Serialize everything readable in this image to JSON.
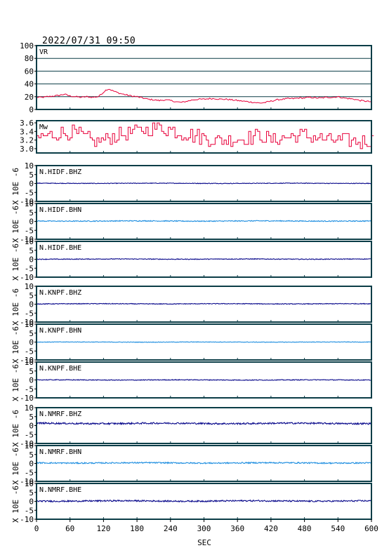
{
  "title": "2022/07/31  09:50",
  "chart_data": {
    "type": "line",
    "title": "2022/07/31  09:50",
    "xlabel": "SEC",
    "xlim": [
      0,
      600
    ],
    "xticks": [
      "0",
      "60",
      "120",
      "180",
      "240",
      "300",
      "360",
      "420",
      "480",
      "540",
      "600"
    ],
    "colors": {
      "red": "#e8003a",
      "navy": "#0a0a8c",
      "azure": "#1e8ee0",
      "frame": "#0b3d47"
    },
    "panels": [
      {
        "label": "VR",
        "ylim": [
          0,
          100
        ],
        "yticks": [
          "100",
          "80",
          "60",
          "40",
          "20",
          "0"
        ],
        "grid": true,
        "color": "red",
        "series_type": "profile",
        "x": [
          0,
          10,
          20,
          30,
          40,
          50,
          60,
          70,
          80,
          90,
          100,
          110,
          115,
          120,
          125,
          130,
          135,
          140,
          150,
          160,
          170,
          180,
          190,
          200,
          210,
          220,
          230,
          240,
          250,
          260,
          270,
          280,
          290,
          300,
          310,
          320,
          330,
          340,
          350,
          360,
          370,
          380,
          390,
          400,
          410,
          420,
          430,
          440,
          450,
          460,
          470,
          480,
          490,
          500,
          510,
          520,
          530,
          540,
          550,
          560,
          570,
          580,
          590,
          600
        ],
        "values": [
          19,
          19,
          20,
          21,
          22,
          24,
          21,
          20,
          19,
          20,
          19,
          20,
          23,
          27,
          31,
          32,
          30,
          28,
          25,
          23,
          21,
          20,
          18,
          16,
          15,
          14,
          15,
          14,
          12,
          11,
          13,
          15,
          16,
          16,
          17,
          17,
          16,
          16,
          15,
          14,
          13,
          12,
          11,
          10,
          11,
          13,
          15,
          16,
          17,
          17,
          18,
          18,
          19,
          18,
          18,
          19,
          19,
          20,
          18,
          17,
          16,
          14,
          13,
          12
        ]
      },
      {
        "label": "Mw",
        "ylim": [
          2.9,
          3.65
        ],
        "yticks": [
          "3.6",
          "3.4",
          "3.2",
          "3.0"
        ],
        "ytick_values": [
          3.6,
          3.4,
          3.2,
          3.0
        ],
        "grid": false,
        "color": "red",
        "series_type": "profile",
        "x": [
          0,
          20,
          40,
          60,
          80,
          100,
          120,
          140,
          160,
          180,
          200,
          220,
          240,
          260,
          280,
          300,
          320,
          340,
          360,
          380,
          400,
          420,
          440,
          460,
          480,
          500,
          520,
          540,
          560,
          580,
          600
        ],
        "values": [
          3.25,
          3.3,
          3.35,
          3.4,
          3.3,
          3.15,
          3.2,
          3.3,
          3.35,
          3.4,
          3.45,
          3.5,
          3.45,
          3.35,
          3.3,
          3.25,
          3.2,
          3.2,
          3.25,
          3.25,
          3.3,
          3.2,
          3.25,
          3.3,
          3.3,
          3.25,
          3.2,
          3.2,
          3.2,
          3.15,
          3.2
        ]
      },
      {
        "label": "N.HIDF.BHZ",
        "ylim": [
          -10,
          10
        ],
        "yticks": [
          "10",
          "5",
          "0",
          "-5",
          "-10"
        ],
        "ylabel": "X 10E -6",
        "color": "navy",
        "series_type": "trace",
        "baseline": 0.1,
        "noise": 0.18
      },
      {
        "label": "N.HIDF.BHN",
        "ylim": [
          -10,
          10
        ],
        "yticks": [
          "10",
          "5",
          "0",
          "-5",
          "-10"
        ],
        "ylabel": "X 10E -6",
        "color": "azure",
        "series_type": "trace",
        "baseline": 0.2,
        "noise": 0.25
      },
      {
        "label": "N.HIDF.BHE",
        "ylim": [
          -10,
          10
        ],
        "yticks": [
          "10",
          "5",
          "0",
          "-5",
          "-10"
        ],
        "ylabel": "X 10E -6",
        "color": "navy",
        "series_type": "trace",
        "baseline": 0.1,
        "noise": 0.2
      },
      {
        "label": "N.KNPF.BHZ",
        "ylim": [
          -10,
          10
        ],
        "yticks": [
          "10",
          "5",
          "0",
          "-5",
          "-10"
        ],
        "ylabel": "X 10E -6",
        "color": "navy",
        "series_type": "trace",
        "baseline": 0.2,
        "noise": 0.2
      },
      {
        "label": "N.KNPF.BHN",
        "ylim": [
          -10,
          10
        ],
        "yticks": [
          "10",
          "5",
          "0",
          "-5",
          "-10"
        ],
        "ylabel": "X 10E -6",
        "color": "azure",
        "series_type": "trace",
        "baseline": 0.0,
        "noise": 0.15
      },
      {
        "label": "N.KNPF.BHE",
        "ylim": [
          -10,
          10
        ],
        "yticks": [
          "10",
          "5",
          "0",
          "-5",
          "-10"
        ],
        "ylabel": "X 10E -6",
        "color": "navy",
        "series_type": "trace",
        "baseline": 0.0,
        "noise": 0.2
      },
      {
        "label": "N.NMRF.BHZ",
        "ylim": [
          -10,
          10
        ],
        "yticks": [
          "10",
          "5",
          "0",
          "-5",
          "-10"
        ],
        "ylabel": "X 10E -6",
        "color": "navy",
        "series_type": "trace",
        "baseline": 1.2,
        "noise": 0.45
      },
      {
        "label": "N.NMRF.BHN",
        "ylim": [
          -10,
          10
        ],
        "yticks": [
          "10",
          "5",
          "0",
          "-5",
          "-10"
        ],
        "ylabel": "X 10E -6",
        "color": "azure",
        "series_type": "trace",
        "baseline": 0.3,
        "noise": 0.35
      },
      {
        "label": "N.NMRF.BHE",
        "ylim": [
          -10,
          10
        ],
        "yticks": [
          "10",
          "5",
          "0",
          "-5",
          "-10"
        ],
        "ylabel": "X 10E -6",
        "color": "navy",
        "series_type": "trace",
        "baseline": 0.2,
        "noise": 0.4
      }
    ]
  }
}
